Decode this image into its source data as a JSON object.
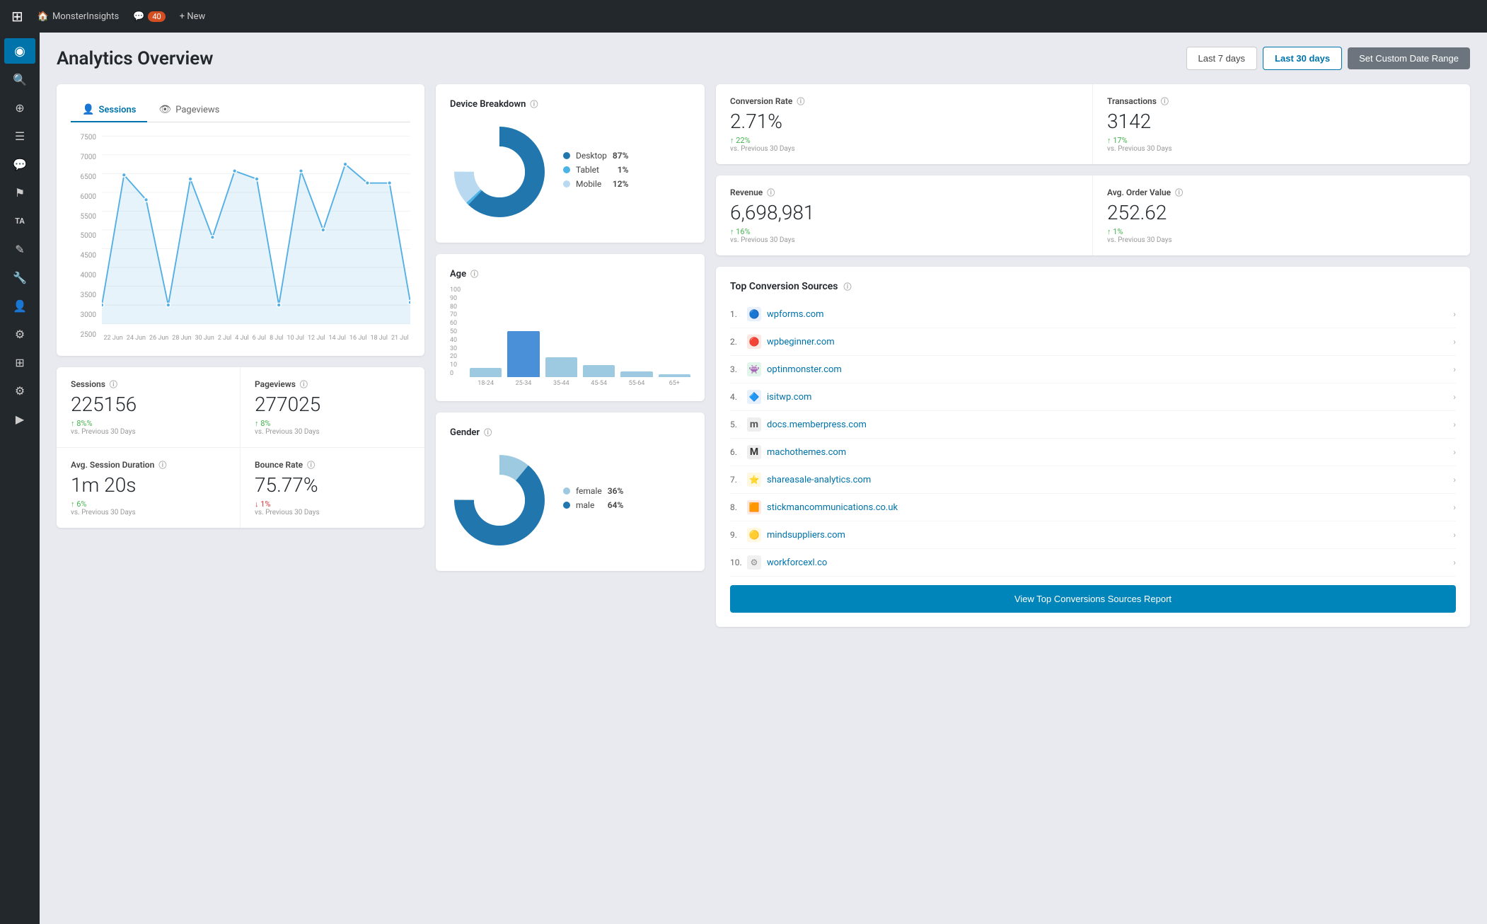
{
  "navbar": {
    "wp_icon": "⊞",
    "site_name": "MonsterInsights",
    "notifications_icon": "💬",
    "notifications_count": "40",
    "new_label": "+ New"
  },
  "sidebar": {
    "items": [
      {
        "icon": "◉",
        "label": "Dashboard",
        "active": true
      },
      {
        "icon": "🔍",
        "label": "Search"
      },
      {
        "icon": "⊕",
        "label": "Add"
      },
      {
        "icon": "☰",
        "label": "Menu"
      },
      {
        "icon": "💬",
        "label": "Comments"
      },
      {
        "icon": "⚑",
        "label": "Flag"
      },
      {
        "icon": "TA",
        "label": "TA"
      },
      {
        "icon": "✎",
        "label": "Edit"
      },
      {
        "icon": "⚙",
        "label": "Settings"
      },
      {
        "icon": "👤",
        "label": "User"
      },
      {
        "icon": "🔧",
        "label": "Tools"
      },
      {
        "icon": "⊞",
        "label": "Plugins"
      },
      {
        "icon": "⚙",
        "label": "Settings2"
      },
      {
        "icon": "▶",
        "label": "Play"
      }
    ]
  },
  "header": {
    "title": "Analytics Overview",
    "date_buttons": [
      {
        "label": "Last 7 days",
        "active": false
      },
      {
        "label": "Last 30 days",
        "active": true
      },
      {
        "label": "Set Custom Date Range",
        "active": false,
        "custom": true
      }
    ]
  },
  "sessions_chart": {
    "sessions_tab": "Sessions",
    "pageviews_tab": "Pageviews",
    "y_labels": [
      "7500",
      "7000",
      "6500",
      "6000",
      "5500",
      "5000",
      "4500",
      "4000",
      "3500",
      "3000",
      "2500"
    ],
    "x_labels": [
      "22 Jun",
      "24 Jun",
      "26 Jun",
      "28 Jun",
      "30 Jun",
      "2 Jul",
      "4 Jul",
      "6 Jul",
      "8 Jul",
      "10 Jul",
      "12 Jul",
      "14 Jul",
      "16 Jul",
      "18 Jul",
      "21 Jul"
    ]
  },
  "stats": {
    "sessions_label": "Sessions",
    "sessions_value": "225156",
    "sessions_change": "↑ 8%%",
    "sessions_vs": "vs. Previous 30 Days",
    "pageviews_label": "Pageviews",
    "pageviews_value": "277025",
    "pageviews_change": "↑ 8%",
    "pageviews_vs": "vs. Previous 30 Days",
    "avg_session_label": "Avg. Session Duration",
    "avg_session_value": "1m 20s",
    "avg_session_change": "↑ 6%",
    "avg_session_vs": "vs. Previous 30 Days",
    "bounce_label": "Bounce Rate",
    "bounce_value": "75.77%",
    "bounce_change": "↓ 1%",
    "bounce_vs": "vs. Previous 30 Days"
  },
  "device_breakdown": {
    "title": "Device Breakdown",
    "segments": [
      {
        "label": "Desktop",
        "value": 87,
        "pct": "87%",
        "color": "#2176ae"
      },
      {
        "label": "Tablet",
        "value": 1,
        "pct": "1%",
        "color": "#4db3e6"
      },
      {
        "label": "Mobile",
        "value": 12,
        "pct": "12%",
        "color": "#b8d9f0"
      }
    ]
  },
  "age": {
    "title": "Age",
    "bars": [
      {
        "label": "18-24",
        "value": 10
      },
      {
        "label": "25-34",
        "value": 50
      },
      {
        "label": "35-44",
        "value": 22
      },
      {
        "label": "45-54",
        "value": 13
      },
      {
        "label": "55-64",
        "value": 6
      },
      {
        "label": "65+",
        "value": 3
      }
    ],
    "y_labels": [
      "100",
      "90",
      "80",
      "70",
      "60",
      "50",
      "40",
      "30",
      "20",
      "10",
      "0"
    ]
  },
  "gender": {
    "title": "Gender",
    "segments": [
      {
        "label": "female",
        "value": 36,
        "pct": "36%",
        "color": "#9ecae1"
      },
      {
        "label": "male",
        "value": 64,
        "pct": "64%",
        "color": "#2176ae"
      }
    ]
  },
  "conversion_rate": {
    "title": "Conversion Rate",
    "value": "2.71%",
    "change": "↑ 22%",
    "vs": "vs. Previous 30 Days",
    "change_up": true
  },
  "transactions": {
    "title": "Transactions",
    "value": "3142",
    "change": "↑ 17%",
    "vs": "vs. Previous 30 Days",
    "change_up": true
  },
  "revenue": {
    "title": "Revenue",
    "value": "6,698,981",
    "change": "↑ 16%",
    "vs": "vs. Previous 30 Days",
    "change_up": true
  },
  "avg_order_value": {
    "title": "Avg. Order Value",
    "value": "252.62",
    "change": "↑ 1%",
    "vs": "vs. Previous 30 Days",
    "change_up": true
  },
  "top_conversion_sources": {
    "title": "Top Conversion Sources",
    "items": [
      {
        "num": "1.",
        "name": "wpforms.com",
        "icon": "🔵",
        "icon_color": "#4a90d9"
      },
      {
        "num": "2.",
        "name": "wpbeginner.com",
        "icon": "🔴",
        "icon_color": "#e05c2e"
      },
      {
        "num": "3.",
        "name": "optinmonster.com",
        "icon": "👾",
        "icon_color": "#3ac47d"
      },
      {
        "num": "4.",
        "name": "isitwp.com",
        "icon": "🔷",
        "icon_color": "#2176ae"
      },
      {
        "num": "5.",
        "name": "docs.memberpress.com",
        "icon": "Ⓜ",
        "icon_color": "#666"
      },
      {
        "num": "6.",
        "name": "machothemes.com",
        "icon": "Ⓜ",
        "icon_color": "#444"
      },
      {
        "num": "7.",
        "name": "shareasale-analytics.com",
        "icon": "⭐",
        "icon_color": "#f5a623"
      },
      {
        "num": "8.",
        "name": "stickmancommunications.co.uk",
        "icon": "🟧",
        "icon_color": "#e05c2e"
      },
      {
        "num": "9.",
        "name": "mindsuppliers.com",
        "icon": "🟡",
        "icon_color": "#f5a623"
      },
      {
        "num": "10.",
        "name": "workforcexl.co",
        "icon": "⚙",
        "icon_color": "#888"
      }
    ],
    "view_report_btn": "View Top Conversions Sources Report"
  }
}
